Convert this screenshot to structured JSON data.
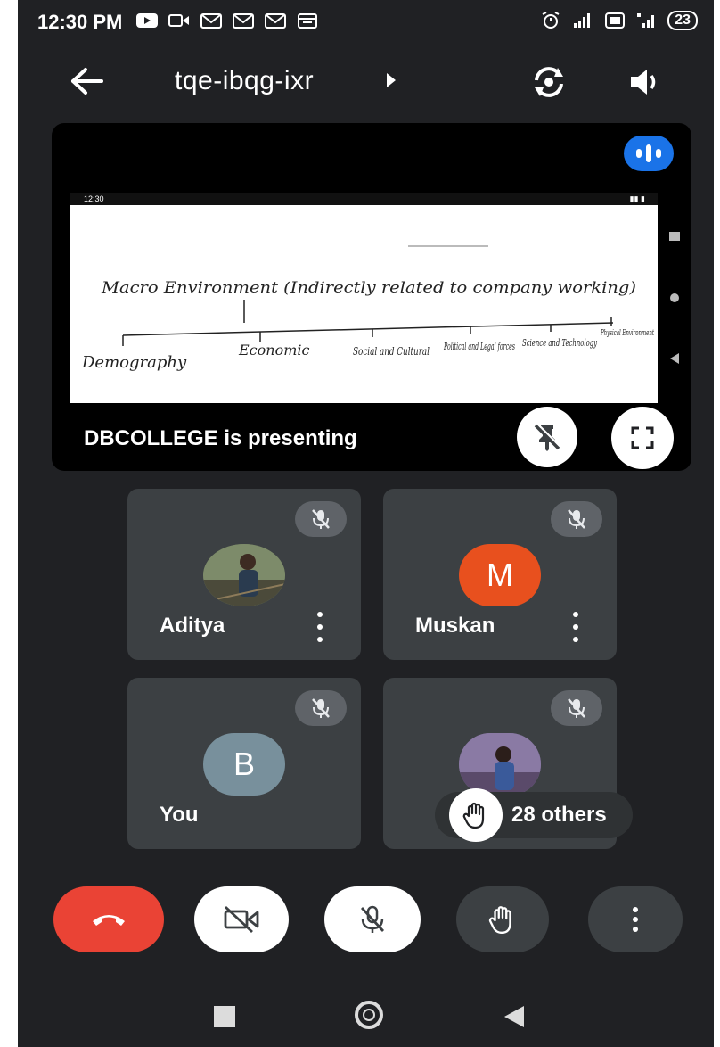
{
  "status_bar": {
    "time": "12:30 PM",
    "battery": "23"
  },
  "header": {
    "meeting_code": "tqe-ibqg-ixr"
  },
  "presentation": {
    "presenting_text": "DBCOLLEGE is presenting",
    "shared_screen": {
      "status_time": "12:30",
      "heading": "Macro Environment (Indirectly related to company working)",
      "branches": [
        "Demography",
        "Economic",
        "Social and Cultural",
        "Political and Legal forces",
        "Science and Technology",
        "Physical Environment"
      ]
    }
  },
  "participants": [
    {
      "name": "Aditya",
      "initial": "",
      "avatar_color": "#5b6b4a"
    },
    {
      "name": "Muskan",
      "initial": "M",
      "avatar_color": "#e8501e"
    },
    {
      "name": "You",
      "initial": "B",
      "avatar_color": "#78909c"
    },
    {
      "name": "",
      "initial": "",
      "avatar_color": "#6a5a8a"
    }
  ],
  "others": {
    "label": "28 others"
  },
  "colors": {
    "background": "#202124",
    "tile": "#3c4043",
    "end_call": "#ea4335",
    "accent": "#1a73e8"
  }
}
